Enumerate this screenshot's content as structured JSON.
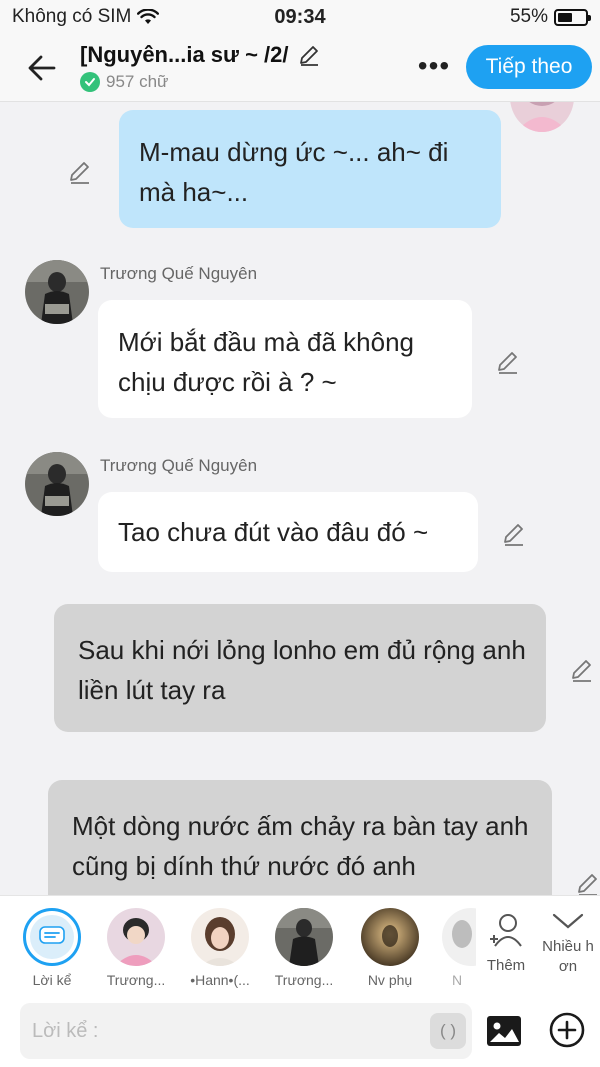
{
  "status_bar": {
    "carrier": "Không có SIM",
    "time": "09:34",
    "battery": "55%",
    "battery_level": 0.55
  },
  "header": {
    "title": "[Nguyên...ia sư ~ /2/",
    "word_count": "957 chữ",
    "next_label": "Tiếp theo",
    "more_label": "•••"
  },
  "messages": [
    {
      "type": "character-right",
      "text": "M-mau dừng ức ~... ah~ đi mà ha~..."
    },
    {
      "type": "character-left",
      "author": "Trương Quế Nguyên",
      "text": "Mới bắt đầu mà đã không chịu được rồi à ? ~"
    },
    {
      "type": "character-left",
      "author": "Trương Quế Nguyên",
      "text": "Tao chưa đút vào đâu đó ~"
    },
    {
      "type": "narration",
      "text": "Sau khi nới lỏng lonho em đủ rộng anh liền lút tay ra"
    },
    {
      "type": "narration",
      "text": "Một dòng nước ấm chảy ra bàn tay anh cũng bị dính thứ nước đó anh"
    }
  ],
  "characters": [
    {
      "label": "Lời kể"
    },
    {
      "label": "Trương..."
    },
    {
      "label": "•Hann•(..."
    },
    {
      "label": "Trương..."
    },
    {
      "label": "Nv phụ"
    },
    {
      "label": "N"
    }
  ],
  "actions": {
    "add_label": "Thêm",
    "more_label": "Nhiều h ơn"
  },
  "input": {
    "placeholder": "Lời kể :",
    "paren_label": "( )"
  }
}
